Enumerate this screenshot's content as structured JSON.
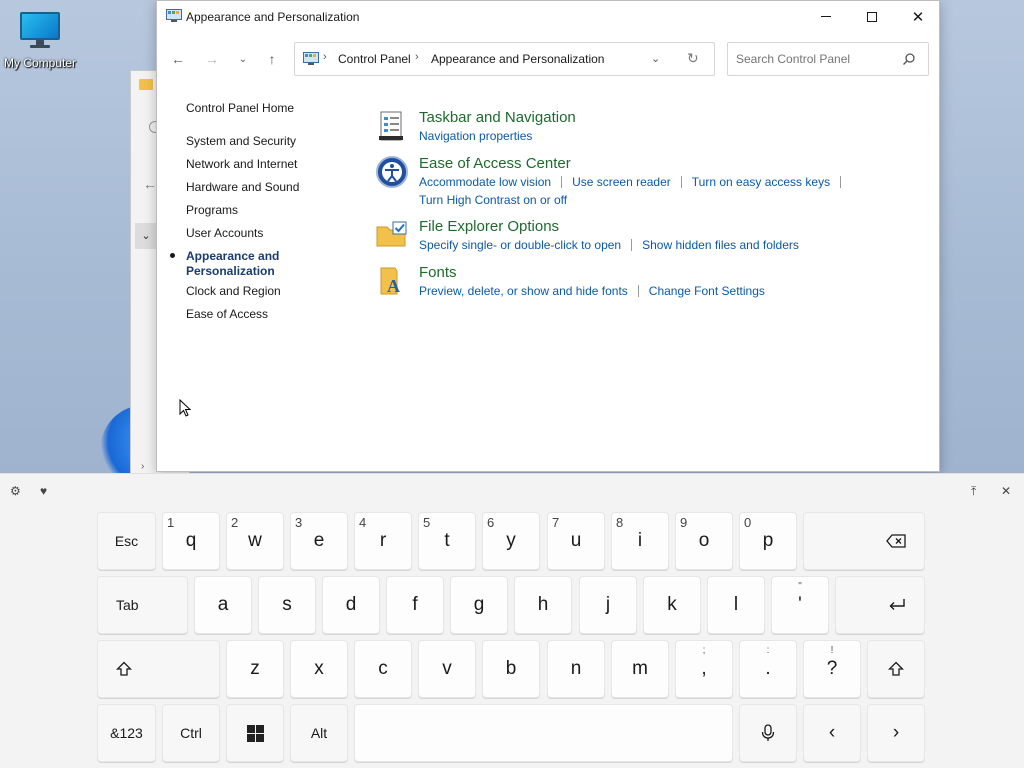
{
  "desktop": {
    "icon_label": "My Computer"
  },
  "window": {
    "title": "Appearance and Personalization",
    "breadcrumbs": [
      "Control Panel",
      "Appearance and Personalization"
    ],
    "search_placeholder": "Search Control Panel"
  },
  "sidebar": {
    "items": [
      {
        "label": "Control Panel Home"
      },
      {
        "label": "System and Security"
      },
      {
        "label": "Network and Internet"
      },
      {
        "label": "Hardware and Sound"
      },
      {
        "label": "Programs"
      },
      {
        "label": "User Accounts"
      },
      {
        "label": "Appearance and",
        "label2": "Personalization",
        "active": true
      },
      {
        "label": "Clock and Region"
      },
      {
        "label": "Ease of Access"
      }
    ]
  },
  "categories": [
    {
      "title": "Taskbar and Navigation",
      "icon": "taskbar-icon",
      "links": [
        "Navigation properties"
      ]
    },
    {
      "title": "Ease of Access Center",
      "icon": "ease-of-access-icon",
      "links": [
        "Accommodate low vision",
        "Use screen reader",
        "Turn on easy access keys",
        "Turn High Contrast on or off"
      ]
    },
    {
      "title": "File Explorer Options",
      "icon": "folder-options-icon",
      "links": [
        "Specify single- or double-click to open",
        "Show hidden files and folders"
      ]
    },
    {
      "title": "Fonts",
      "icon": "fonts-icon",
      "links": [
        "Preview, delete, or show and hide fonts",
        "Change Font Settings"
      ]
    }
  ],
  "keyboard": {
    "row1": {
      "esc": "Esc",
      "keys": [
        {
          "k": "q",
          "h": "1"
        },
        {
          "k": "w",
          "h": "2"
        },
        {
          "k": "e",
          "h": "3"
        },
        {
          "k": "r",
          "h": "4"
        },
        {
          "k": "t",
          "h": "5"
        },
        {
          "k": "y",
          "h": "6"
        },
        {
          "k": "u",
          "h": "7"
        },
        {
          "k": "i",
          "h": "8"
        },
        {
          "k": "o",
          "h": "9"
        },
        {
          "k": "p",
          "h": "0"
        }
      ]
    },
    "row2": {
      "tab": "Tab",
      "keys": [
        "a",
        "s",
        "d",
        "f",
        "g",
        "h",
        "j",
        "k",
        "l"
      ],
      "quote": {
        "k": "'",
        "s": "\""
      }
    },
    "row3": {
      "keys": [
        "z",
        "x",
        "c",
        "v",
        "b",
        "n",
        "m"
      ],
      "comma": {
        "k": ",",
        "s": ";"
      },
      "period": {
        "k": ".",
        "s": ":"
      },
      "question": {
        "k": "?",
        "s": "!"
      }
    },
    "row4": {
      "sym": "&123",
      "ctrl": "Ctrl",
      "alt": "Alt"
    }
  }
}
